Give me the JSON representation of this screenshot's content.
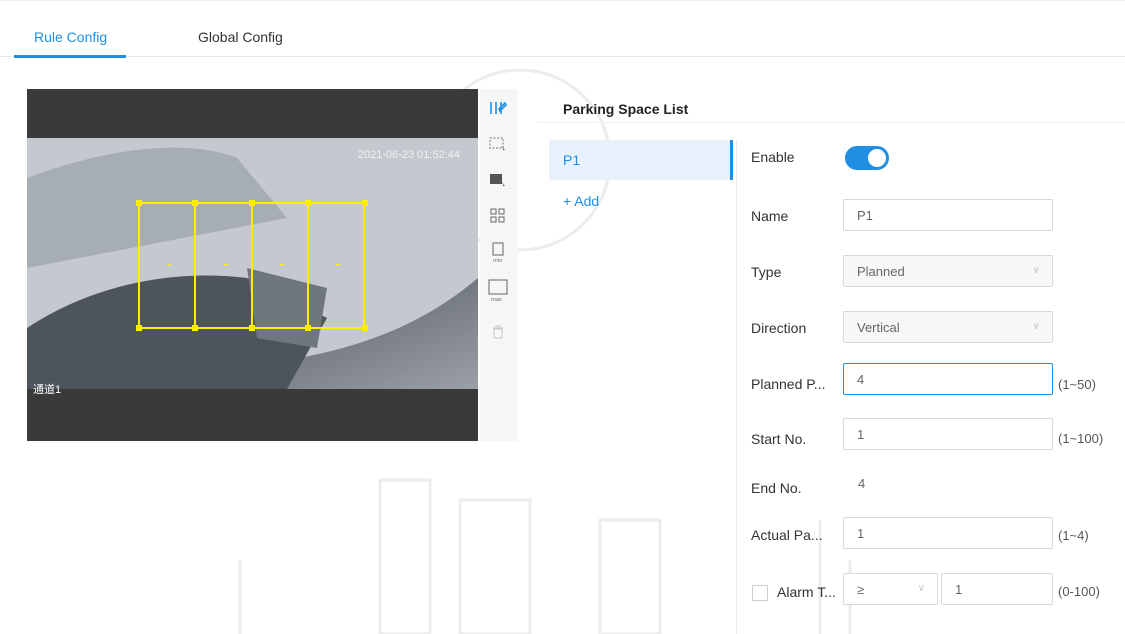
{
  "tabs": [
    {
      "label": "Rule Config",
      "active": true
    },
    {
      "label": "Global Config",
      "active": false
    }
  ],
  "video": {
    "timestamp": "2021-06-23 01:52:44",
    "channel_label": "通道1",
    "space_count": 4
  },
  "toolbar": {
    "tools": [
      "draw-parking-icon",
      "select-area-icon",
      "select-area-alt-icon",
      "grid-icon",
      "min-size-icon",
      "max-size-icon",
      "delete-icon"
    ]
  },
  "parking_list": {
    "title": "Parking Space List",
    "items": [
      "P1"
    ],
    "add_label": "+ Add"
  },
  "form": {
    "enable": {
      "label": "Enable",
      "value": true
    },
    "name": {
      "label": "Name",
      "value": "P1"
    },
    "type": {
      "label": "Type",
      "value": "Planned"
    },
    "direction": {
      "label": "Direction",
      "value": "Vertical"
    },
    "planned": {
      "label": "Planned P...",
      "value": "4",
      "range": "(1~50)"
    },
    "start_no": {
      "label": "Start No.",
      "value": "1",
      "range": "(1~100)"
    },
    "end_no": {
      "label": "End No.",
      "value": "4"
    },
    "actual": {
      "label": "Actual Pa...",
      "value": "1",
      "range": "(1~4)"
    },
    "alarm": {
      "label": "Alarm T...",
      "operator": "≥",
      "value": "1",
      "range": "(0-100)",
      "checked": false
    }
  },
  "colors": {
    "accent": "#1f8fe3",
    "zone": "#ffee00"
  }
}
